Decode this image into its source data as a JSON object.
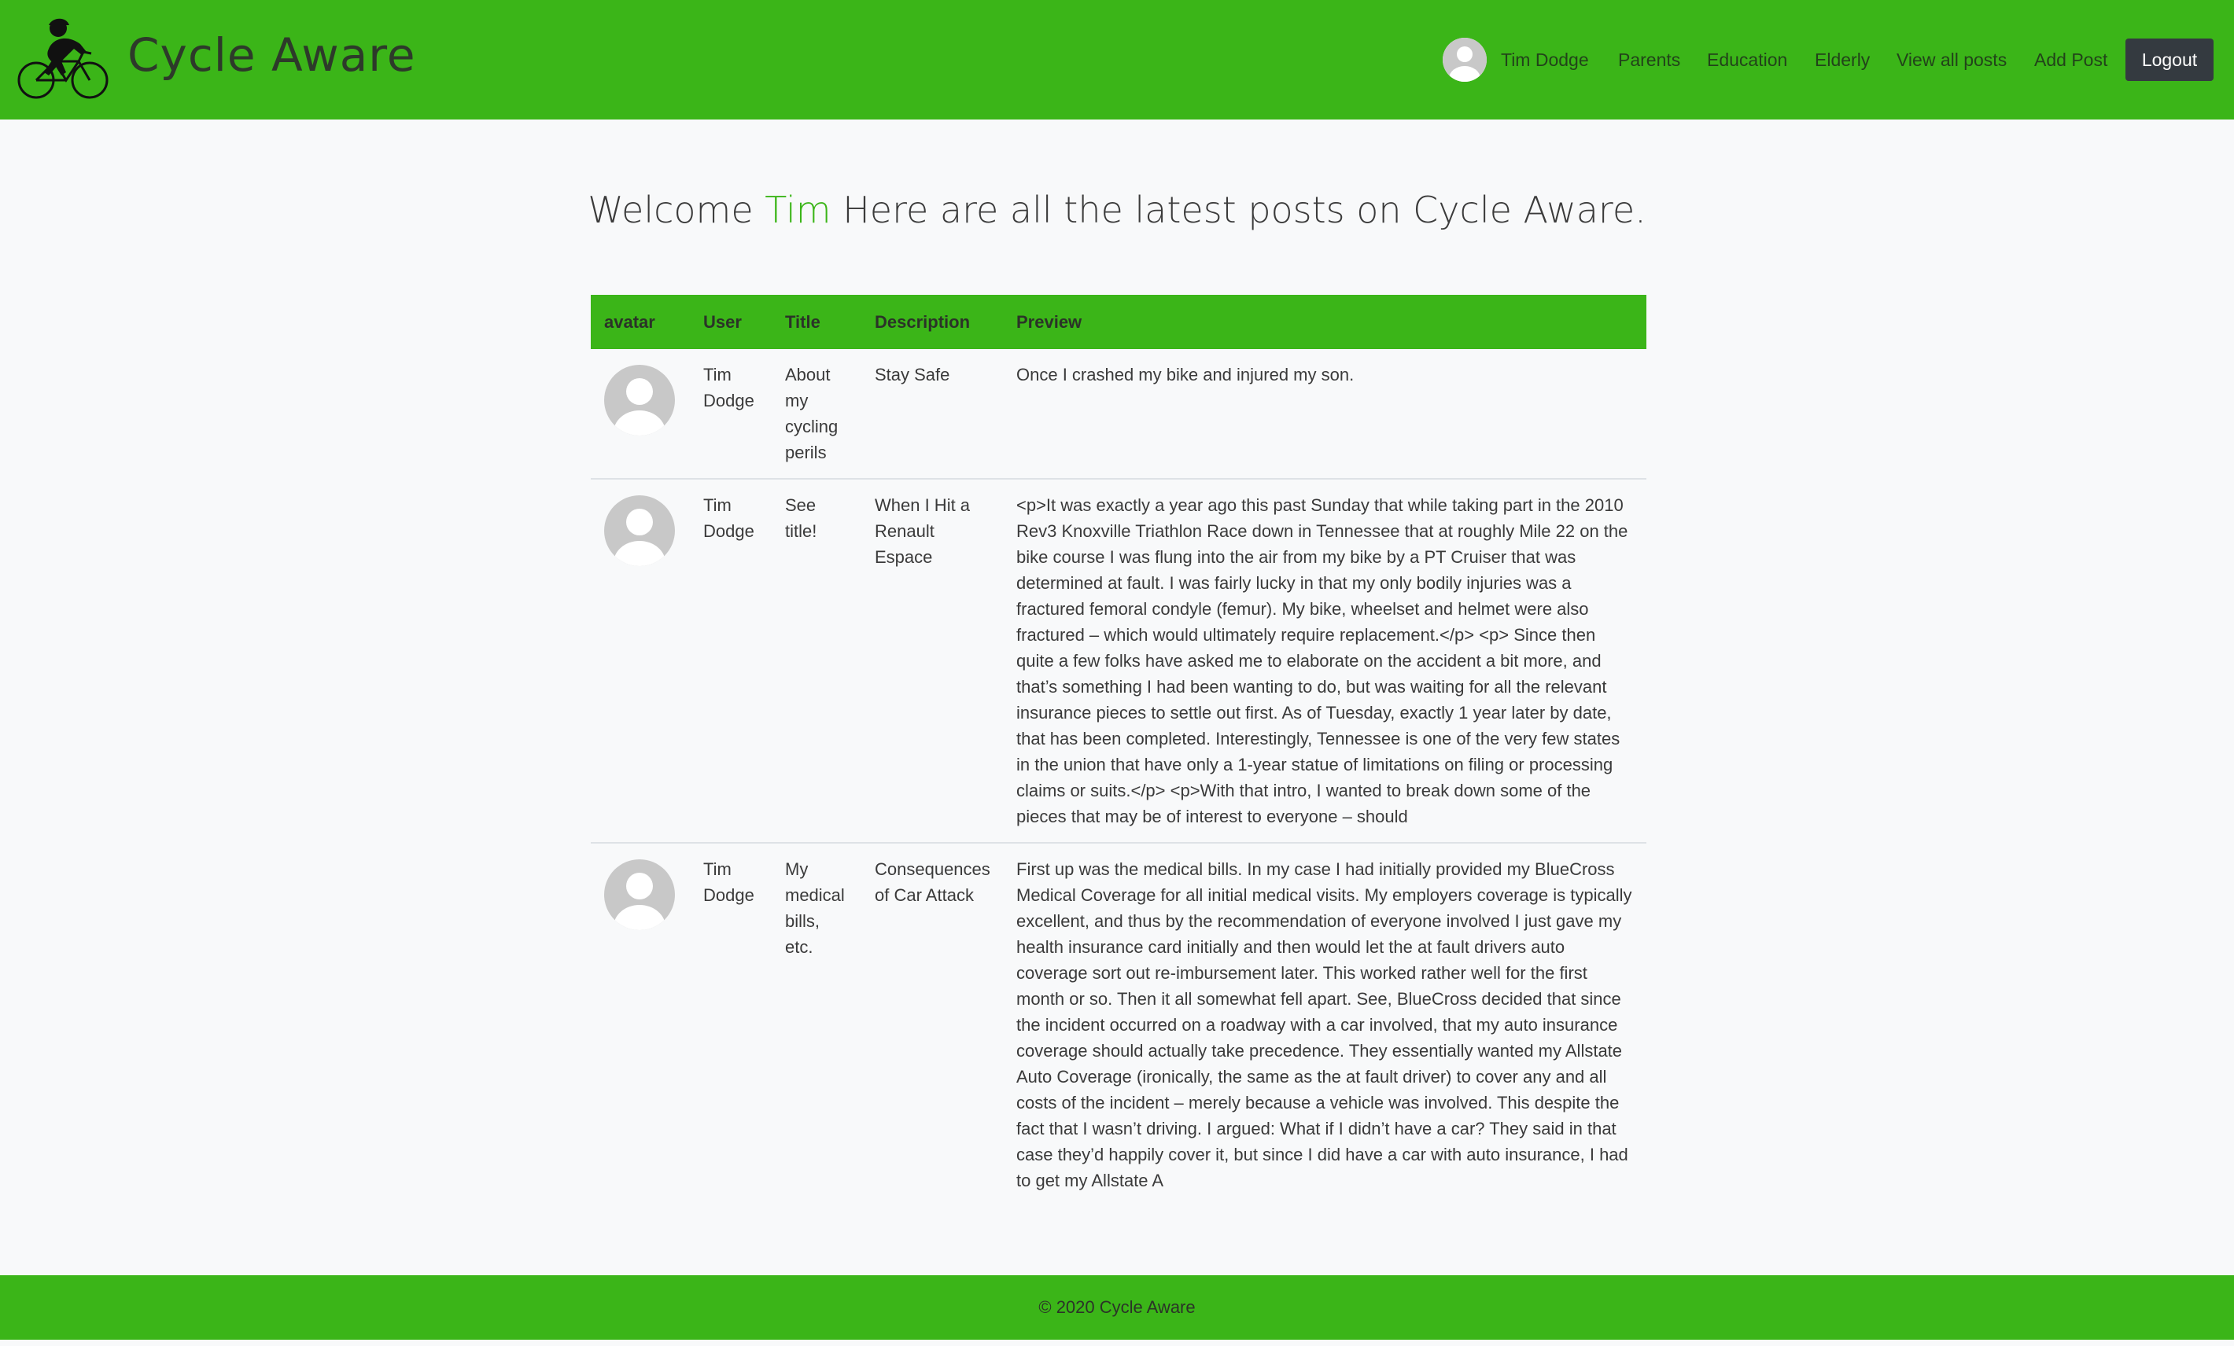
{
  "brand": {
    "title": "Cycle Aware",
    "logo_icon": "cyclist-icon"
  },
  "nav": {
    "user_name": "Tim Dodge",
    "avatar_icon": "user-avatar-icon",
    "links": [
      {
        "label": "Parents"
      },
      {
        "label": "Education"
      },
      {
        "label": "Elderly"
      },
      {
        "label": "View all posts"
      },
      {
        "label": "Add Post"
      }
    ],
    "logout_label": "Logout"
  },
  "welcome": {
    "prefix": "Welcome",
    "name": "Tim",
    "suffix": "Here are all the latest posts on Cycle Aware."
  },
  "table": {
    "headers": [
      "avatar",
      "User",
      "Title",
      "Description",
      "Preview"
    ],
    "rows": [
      {
        "user": "Tim Dodge",
        "title": "About my cycling perils",
        "description": "Stay Safe",
        "preview": "Once I crashed my bike and injured my son."
      },
      {
        "user": "Tim Dodge",
        "title": "See title!",
        "description": "When I Hit a Renault Espace",
        "preview": "<p>It was exactly a year ago this past Sunday that while taking part in the 2010 Rev3 Knoxville Triathlon Race down in Tennessee that at roughly Mile 22 on the bike course I was flung into the air from my bike by a PT Cruiser that was determined at fault. I was fairly lucky in that my only bodily injuries was a fractured femoral condyle (femur). My bike, wheelset and helmet were also fractured – which would ultimately require replacement.</p> <p> Since then quite a few folks have asked me to elaborate on the accident a bit more, and that’s something I had been wanting to do, but was waiting for all the relevant insurance pieces to settle out first. As of Tuesday, exactly 1 year later by date, that has been completed. Interestingly, Tennessee is one of the very few states in the union that have only a 1-year statue of limitations on filing or processing claims or suits.</p> <p>With that intro, I wanted to break down some of the pieces that may be of interest to everyone – should"
      },
      {
        "user": "Tim Dodge",
        "title": "My medical bills, etc.",
        "description": "Consequences of Car Attack",
        "preview": "First up was the medical bills. In my case I had initially provided my BlueCross Medical Coverage for all initial medical visits. My employers coverage is typically excellent, and thus by the recommendation of everyone involved I just gave my health insurance card initially and then would let the at fault drivers auto coverage sort out re-imbursement later. This worked rather well for the first month or so. Then it all somewhat fell apart. See, BlueCross decided that since the incident occurred on a roadway with a car involved, that my auto insurance coverage should actually take precedence. They essentially wanted my Allstate Auto Coverage (ironically, the same as the at fault driver) to cover any and all costs of the incident – merely because a vehicle was involved. This despite the fact that I wasn’t driving. I argued: What if I didn’t have a car? They said in that case they’d happily cover it, but since I did have a car with auto insurance, I had to get my Allstate A"
      }
    ]
  },
  "footer": {
    "text": "© 2020 Cycle Aware"
  },
  "colors": {
    "brand_green": "#3bb518",
    "dark_button": "#343a40",
    "page_background": "#f8f9fa"
  }
}
